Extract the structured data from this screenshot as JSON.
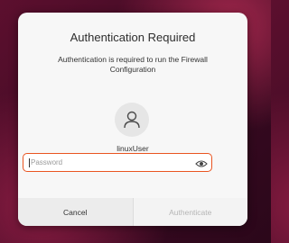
{
  "dialog": {
    "title": "Authentication Required",
    "message_line1": "Authentication is required to run the Firewall",
    "message_line2": "Configuration",
    "username": "linuxUser",
    "password_placeholder": "Password",
    "cancel_label": "Cancel",
    "authenticate_label": "Authenticate"
  },
  "icons": {
    "avatar": "user-icon",
    "reveal": "eye-icon"
  },
  "colors": {
    "accent": "#e95420",
    "dialog_bg": "#f7f7f7",
    "disabled_text": "#b5b5b5"
  }
}
